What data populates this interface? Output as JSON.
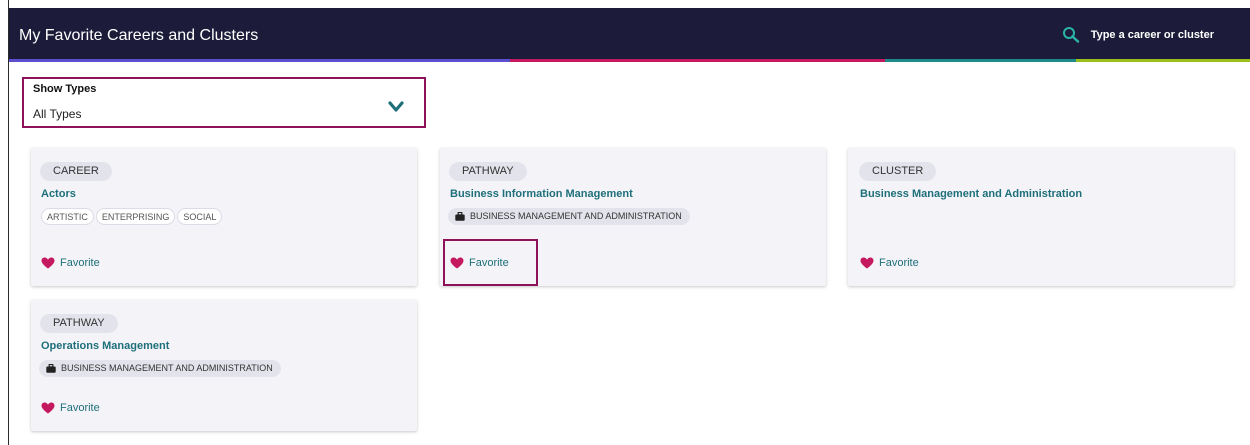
{
  "header": {
    "title": "My Favorite Careers and Clusters",
    "search_placeholder": "Type a career or cluster",
    "stripe_colors": [
      "#5b4fd0",
      "#c4195e",
      "#1f8a8a",
      "#9bc01c"
    ]
  },
  "filter": {
    "label": "Show Types",
    "selected": "All Types"
  },
  "colors": {
    "accent": "#1e6f7a",
    "highlight": "#8e1259",
    "heart": "#c4195e",
    "header_bg": "#1c1c3a"
  },
  "cards": [
    {
      "type": "CAREER",
      "title": "Actors",
      "tags": [
        "ARTISTIC",
        "ENTERPRISING",
        "SOCIAL"
      ],
      "favorite_label": "Favorite"
    },
    {
      "type": "PATHWAY",
      "title": "Business Information Management",
      "cluster": "BUSINESS MANAGEMENT AND ADMINISTRATION",
      "favorite_label": "Favorite"
    },
    {
      "type": "CLUSTER",
      "title": "Business Management and Administration",
      "favorite_label": "Favorite"
    },
    {
      "type": "PATHWAY",
      "title": "Operations Management",
      "cluster": "BUSINESS MANAGEMENT AND ADMINISTRATION",
      "favorite_label": "Favorite"
    }
  ]
}
